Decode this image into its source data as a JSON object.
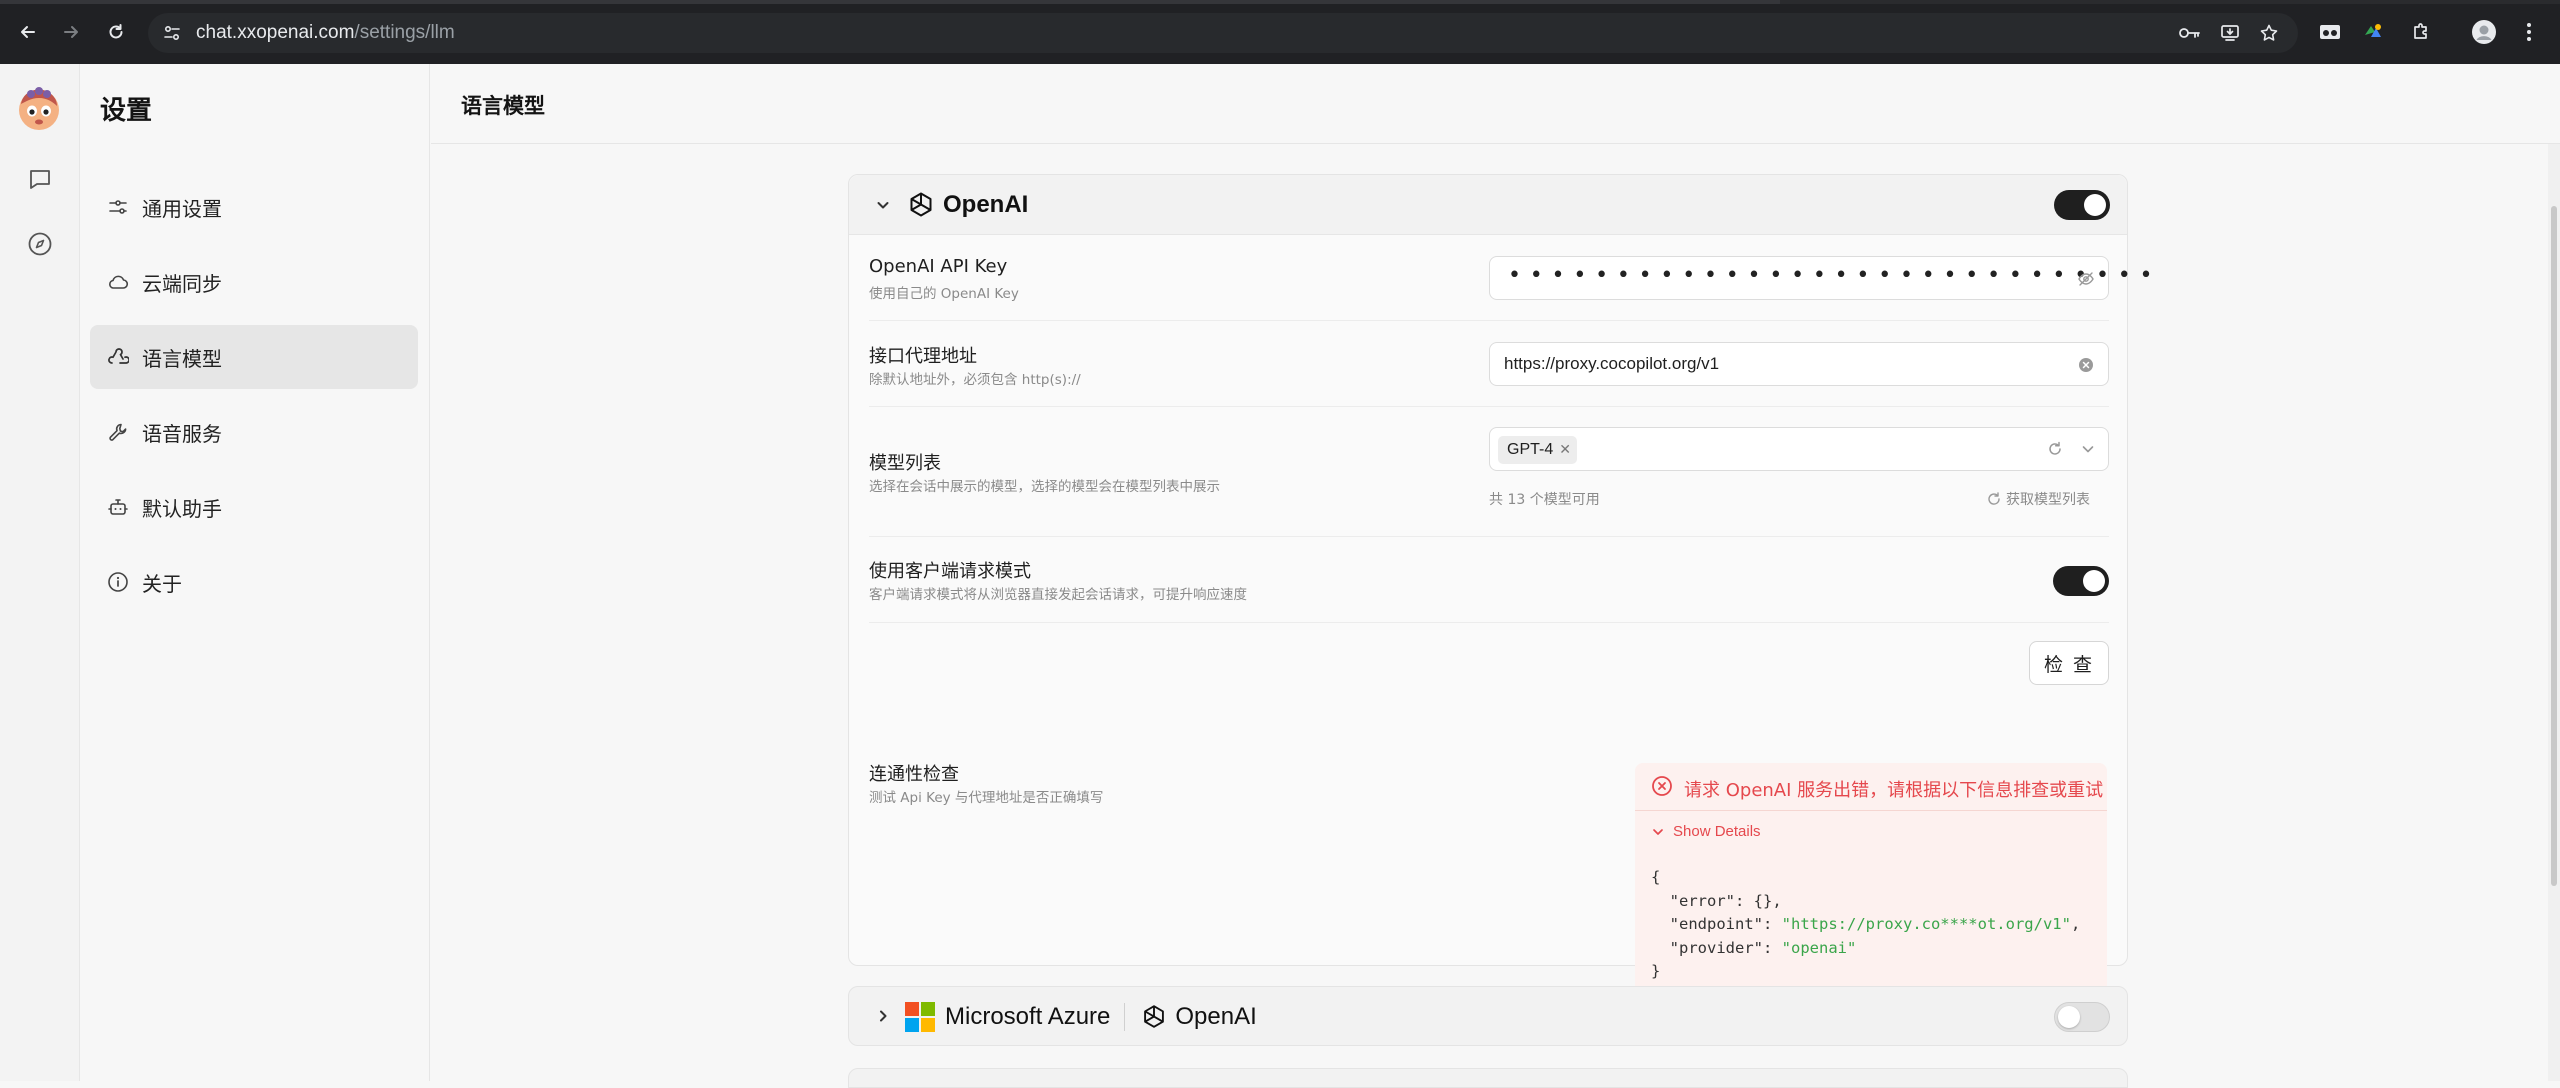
{
  "browser": {
    "url_host": "chat.xxopenai.com",
    "url_path": "/settings/llm"
  },
  "sidebar": {
    "title": "设置",
    "items": [
      {
        "label": "通用设置",
        "icon": "sliders-icon",
        "active": false
      },
      {
        "label": "云端同步",
        "icon": "cloud-icon",
        "active": false
      },
      {
        "label": "语言模型",
        "icon": "webhook-icon",
        "active": true
      },
      {
        "label": "语音服务",
        "icon": "wrench-icon",
        "active": false
      },
      {
        "label": "默认助手",
        "icon": "bot-icon",
        "active": false
      },
      {
        "label": "关于",
        "icon": "info-icon",
        "active": false
      }
    ]
  },
  "main": {
    "title": "语言模型"
  },
  "openai": {
    "name": "OpenAI",
    "enabled": true,
    "api_key": {
      "label": "OpenAI API Key",
      "desc": "使用自己的 OpenAI Key",
      "masked_value": "••••••••••••••••••••••••••••••"
    },
    "proxy": {
      "label": "接口代理地址",
      "desc": "除默认地址外，必须包含 http(s)://",
      "value": "https://proxy.cocopilot.org/v1"
    },
    "models": {
      "label": "模型列表",
      "desc": "选择在会话中展示的模型，选择的模型会在模型列表中展示",
      "selected": "GPT-4",
      "count_text": "共 13 个模型可用",
      "fetch_label": "获取模型列表"
    },
    "client_mode": {
      "label": "使用客户端请求模式",
      "desc": "客户端请求模式将从浏览器直接发起会话请求，可提升响应速度",
      "enabled": true
    },
    "connectivity": {
      "label": "连通性检查",
      "desc": "测试 Api Key 与代理地址是否正确填写",
      "button": "检 查",
      "error_message": "请求 OpenAI 服务出错，请根据以下信息排查或重试",
      "show_details": "Show Details",
      "details": {
        "open_brace": "{",
        "error_key": "\"error\"",
        "error_val": "{}",
        "endpoint_key": "\"endpoint\"",
        "endpoint_val": "\"https://proxy.co****ot.org/v1\"",
        "provider_key": "\"provider\"",
        "provider_val": "\"openai\"",
        "close_brace": "}"
      }
    }
  },
  "azure": {
    "name": "Microsoft Azure",
    "sub_name": "OpenAI",
    "enabled": false
  },
  "colors": {
    "error": "#e5484d",
    "toggle_on": "#1f1f1f",
    "json_string": "#3aa54a"
  }
}
